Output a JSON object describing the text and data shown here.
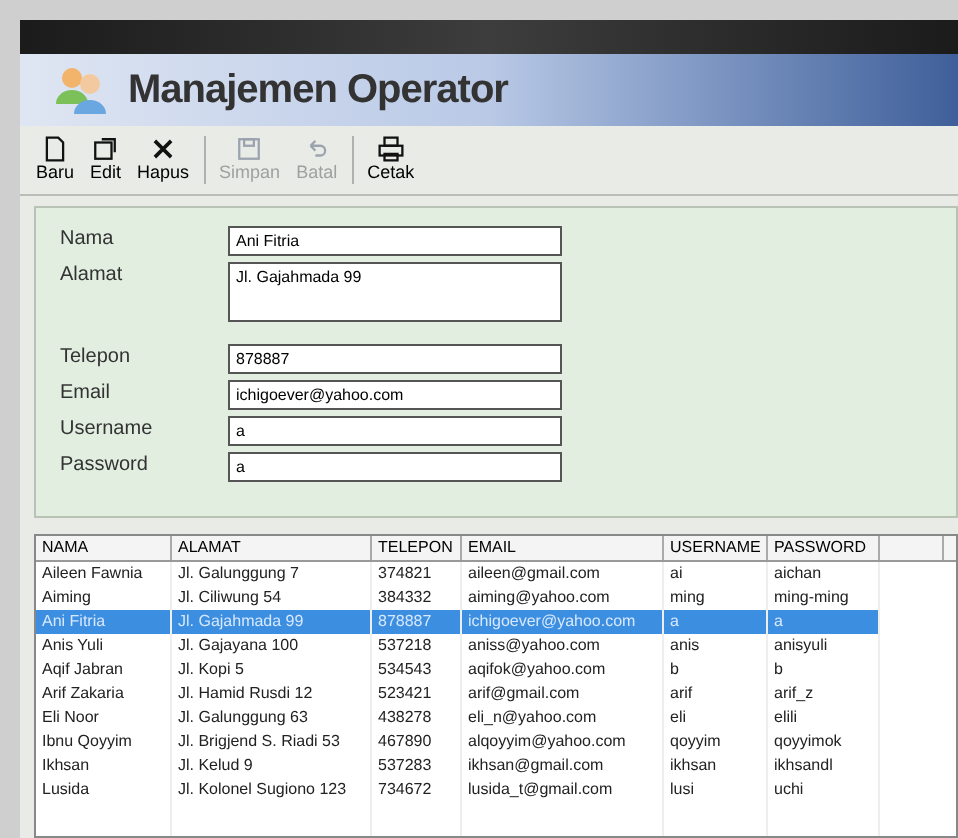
{
  "window": {
    "title": "Manajemen Operator"
  },
  "toolbar": [
    {
      "label": "Baru",
      "kind": "new",
      "disabled": false
    },
    {
      "label": "Edit",
      "kind": "edit",
      "disabled": false
    },
    {
      "label": "Hapus",
      "kind": "delete",
      "disabled": false
    },
    {
      "kind": "separator"
    },
    {
      "label": "Simpan",
      "kind": "save",
      "disabled": true
    },
    {
      "label": "Batal",
      "kind": "undo",
      "disabled": true
    },
    {
      "kind": "separator"
    },
    {
      "label": "Cetak",
      "kind": "print",
      "disabled": false
    }
  ],
  "form": [
    {
      "label": "Nama",
      "value": "Ani Fitria",
      "kind": "text"
    },
    {
      "label": "Alamat",
      "value": "Jl. Gajahmada 99",
      "kind": "multiline"
    },
    {
      "label": "Telepon",
      "value": "878887",
      "kind": "text"
    },
    {
      "label": "Email",
      "value": "ichigoever@yahoo.com",
      "kind": "text"
    },
    {
      "label": "Username",
      "value": "a",
      "kind": "text"
    },
    {
      "label": "Password",
      "value": "a",
      "kind": "text"
    }
  ],
  "table": {
    "columns": [
      "NAMA",
      "ALAMAT",
      "TELEPON",
      "EMAIL",
      "USERNAME",
      "PASSWORD"
    ],
    "rows": [
      {
        "cells": [
          "Aileen Fawnia",
          "Jl. Galunggung 7",
          "374821",
          "aileen@gmail.com",
          "ai",
          "aichan"
        ],
        "selected": false
      },
      {
        "cells": [
          "Aiming",
          "Jl. Ciliwung 54",
          "384332",
          "aiming@yahoo.com",
          "ming",
          "ming-ming"
        ],
        "selected": false
      },
      {
        "cells": [
          "Ani Fitria",
          "Jl. Gajahmada 99",
          "878887",
          "ichigoever@yahoo.com",
          "a",
          "a"
        ],
        "selected": true
      },
      {
        "cells": [
          "Anis Yuli",
          "Jl. Gajayana 100",
          "537218",
          "aniss@yahoo.com",
          "anis",
          "anisyuli"
        ],
        "selected": false
      },
      {
        "cells": [
          "Aqif Jabran",
          "Jl. Kopi 5",
          "534543",
          "aqifok@yahoo.com",
          "b",
          "b"
        ],
        "selected": false
      },
      {
        "cells": [
          "Arif Zakaria",
          "Jl. Hamid Rusdi 12",
          "523421",
          "arif@gmail.com",
          "arif",
          "arif_z"
        ],
        "selected": false
      },
      {
        "cells": [
          "Eli Noor",
          "Jl. Galunggung 63",
          "438278",
          "eli_n@yahoo.com",
          "eli",
          "elili"
        ],
        "selected": false
      },
      {
        "cells": [
          "Ibnu Qoyyim",
          "Jl. Brigjend S. Riadi 53",
          "467890",
          "alqoyyim@yahoo.com",
          "qoyyim",
          "qoyyimok"
        ],
        "selected": false
      },
      {
        "cells": [
          "Ikhsan",
          "Jl. Kelud 9",
          "537283",
          "ikhsan@gmail.com",
          "ikhsan",
          "ikhsandl"
        ],
        "selected": false
      },
      {
        "cells": [
          "Lusida",
          "Jl. Kolonel Sugiono 123",
          "734672",
          "lusida_t@gmail.com",
          "lusi",
          "uchi"
        ],
        "selected": false
      }
    ]
  }
}
